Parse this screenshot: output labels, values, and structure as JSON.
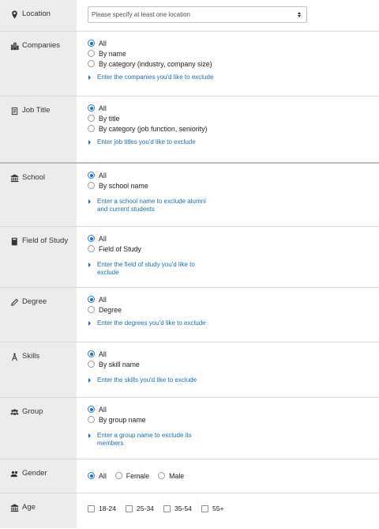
{
  "location": {
    "label": "Location",
    "icon": "map-pin-icon",
    "placeholder": "Please specify at least one location"
  },
  "companies": {
    "label": "Companies",
    "icon": "buildings-icon",
    "options": [
      "All",
      "By name",
      "By category (industry, company size)"
    ],
    "selected": "All",
    "exclude": "Enter the companies you'd like to exclude"
  },
  "job_title": {
    "label": "Job Title",
    "icon": "id-card-icon",
    "options": [
      "All",
      "By title",
      "By category (job function, seniority)"
    ],
    "selected": "All",
    "exclude": "Enter job titles you'd like to exclude"
  },
  "school": {
    "label": "School",
    "icon": "institution-icon",
    "options": [
      "All",
      "By school name"
    ],
    "selected": "All",
    "exclude": "Enter a school name to exclude alumni and current students"
  },
  "field_of_study": {
    "label": "Field of Study",
    "icon": "book-icon",
    "options": [
      "All",
      "Field of Study"
    ],
    "selected": "All",
    "exclude": "Enter the field of study you'd like to exclude"
  },
  "degree": {
    "label": "Degree",
    "icon": "pen-icon",
    "options": [
      "All",
      "Degree"
    ],
    "selected": "All",
    "exclude": "Enter the degrees you'd like to exclude"
  },
  "skills": {
    "label": "Skills",
    "icon": "compass-icon",
    "options": [
      "All",
      "By skill name"
    ],
    "selected": "All",
    "exclude": "Enter the skills you'd like to exclude"
  },
  "group": {
    "label": "Group",
    "icon": "group-icon",
    "options": [
      "All",
      "By group name"
    ],
    "selected": "All",
    "exclude": "Enter a group name to exclude its members"
  },
  "gender": {
    "label": "Gender",
    "icon": "people-icon",
    "options": [
      "All",
      "Female",
      "Male"
    ],
    "selected": "All"
  },
  "age": {
    "label": "Age",
    "icon": "institution-icon",
    "options": [
      "18-24",
      "25-34",
      "35-54",
      "55+"
    ]
  },
  "colors": {
    "accent": "#1d6fb8",
    "sidebar": "#ececec"
  }
}
